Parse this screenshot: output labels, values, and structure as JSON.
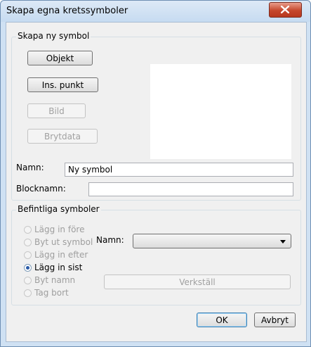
{
  "window": {
    "title": "Skapa egna kretssymboler"
  },
  "new_symbol": {
    "legend": "Skapa ny symbol",
    "buttons": {
      "objekt": "Objekt",
      "ins_punkt": "Ins. punkt",
      "bild": "Bild",
      "brytdata": "Brytdata"
    },
    "name_label": "Namn:",
    "name_value": "Ny symbol",
    "block_label": "Blocknamn:",
    "block_value": ""
  },
  "existing": {
    "legend": "Befintliga symboler",
    "options": [
      {
        "label": "Lägg in före",
        "enabled": false,
        "checked": false
      },
      {
        "label": "Byt ut symbol",
        "enabled": false,
        "checked": false
      },
      {
        "label": "Lägg in efter",
        "enabled": false,
        "checked": false
      },
      {
        "label": "Lägg in sist",
        "enabled": true,
        "checked": true
      },
      {
        "label": "Byt namn",
        "enabled": false,
        "checked": false
      },
      {
        "label": "Tag bort",
        "enabled": false,
        "checked": false
      }
    ],
    "name_label": "Namn:",
    "name_selected": "",
    "apply_label": "Verkställ"
  },
  "footer": {
    "ok_label": "OK",
    "cancel_label": "Avbryt"
  },
  "icons": {
    "close": "close-icon"
  },
  "colors": {
    "close_button": "#c5462c",
    "title_bar": "#cfe1f3",
    "dialog_bg": "#f0f0f0"
  }
}
